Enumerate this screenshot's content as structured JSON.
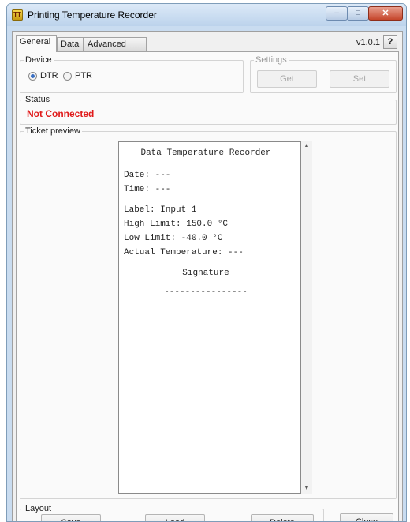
{
  "window": {
    "title": "Printing Temperature Recorder",
    "icon": "app-icon",
    "app_icon_text": "ТТ"
  },
  "window_controls": {
    "minimize": "–",
    "maximize": "□",
    "close": "✕"
  },
  "tabs": [
    {
      "label": "General",
      "active": true
    },
    {
      "label": "Data",
      "active": false
    },
    {
      "label": "Advanced",
      "active": false
    }
  ],
  "version": "v1.0.1",
  "help_label": "?",
  "device": {
    "label": "Device",
    "options": [
      {
        "label": "DTR",
        "selected": true
      },
      {
        "label": "PTR",
        "selected": false
      }
    ]
  },
  "settings": {
    "label": "Settings",
    "get_label": "Get",
    "set_label": "Set",
    "enabled": false
  },
  "status": {
    "label": "Status",
    "value": "Not Connected",
    "color": "#e01a1a"
  },
  "preview": {
    "label": "Ticket preview",
    "title": "Data Temperature Recorder",
    "date": "Date: ---",
    "time": "Time: ---",
    "label_line": "Label: Input 1",
    "high_limit": "High Limit: 150.0 °C",
    "low_limit": "Low Limit: -40.0 °C",
    "actual_temp": "Actual Temperature: ---",
    "signature": "Signature",
    "signature_line": "----------------"
  },
  "layout": {
    "label": "Layout",
    "save_label": "Save",
    "load_label": "Load",
    "delete_label": "Delete"
  },
  "close_label": "Close",
  "colors": {
    "accent": "#3a6fc2",
    "status_error": "#e01a1a"
  }
}
